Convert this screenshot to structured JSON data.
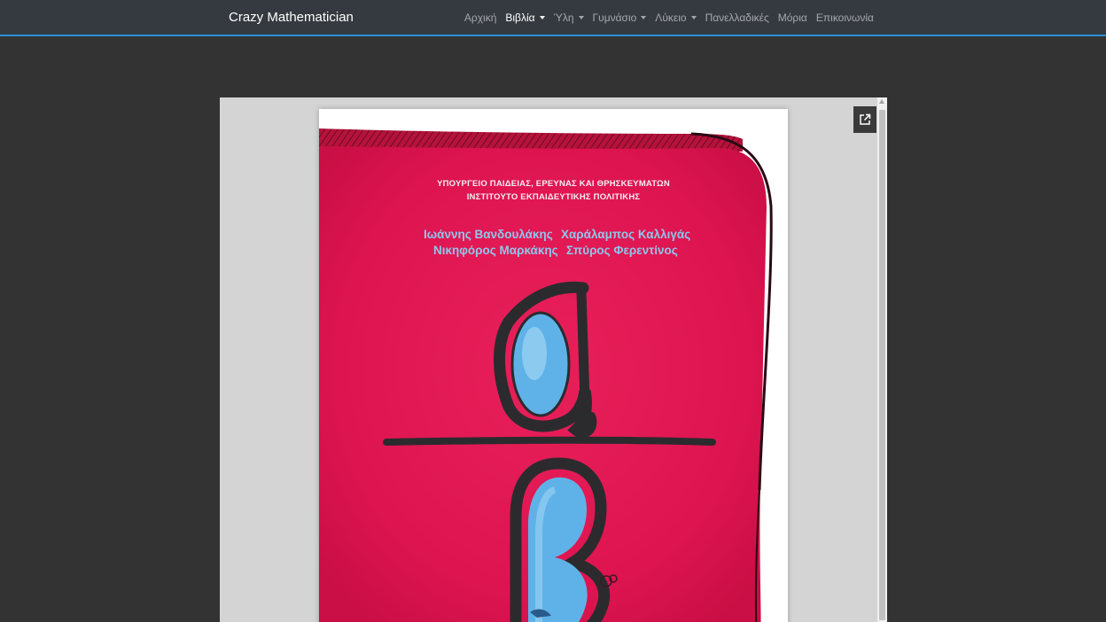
{
  "navbar": {
    "brand": "Crazy Mathematician",
    "items": [
      {
        "label": "Αρχική",
        "dropdown": false,
        "active": false
      },
      {
        "label": "Βιβλία",
        "dropdown": true,
        "active": true
      },
      {
        "label": "Ύλη",
        "dropdown": true,
        "active": false
      },
      {
        "label": "Γυμνάσιο",
        "dropdown": true,
        "active": false
      },
      {
        "label": "Λύκειο",
        "dropdown": true,
        "active": false
      },
      {
        "label": "Πανελλαδικές",
        "dropdown": false,
        "active": false
      },
      {
        "label": "Μόρια",
        "dropdown": false,
        "active": false
      },
      {
        "label": "Επικοινωνία",
        "dropdown": false,
        "active": false
      }
    ]
  },
  "viewer": {
    "popout_icon": "open-in-new-icon",
    "cover": {
      "ministry": "ΥΠΟΥΡΓΕΙΟ ΠΑΙΔΕΙΑΣ, ΕΡΕΥΝΑΣ ΚΑΙ ΘΡΗΣΚΕΥΜΑΤΩΝ",
      "institute": "ΙΝΣΤΙΤΟΥΤΟ ΕΚΠΑΙΔΕΥΤΙΚΗΣ ΠΟΛΙΤΙΚΗΣ",
      "authors": [
        "Ιωάννης Βανδουλάκης",
        "Χαράλαμπος Καλλιγάς",
        "Νικηφόρος Μαρκάκης",
        "Σπύρος Φερεντίνος"
      ]
    }
  },
  "colors": {
    "navbar_bg": "#343a40",
    "navbar_accent": "#2b8fd6",
    "page_bg": "#333333",
    "cover_red": "#e0174f",
    "cover_author_blue": "#8fc6ec"
  }
}
